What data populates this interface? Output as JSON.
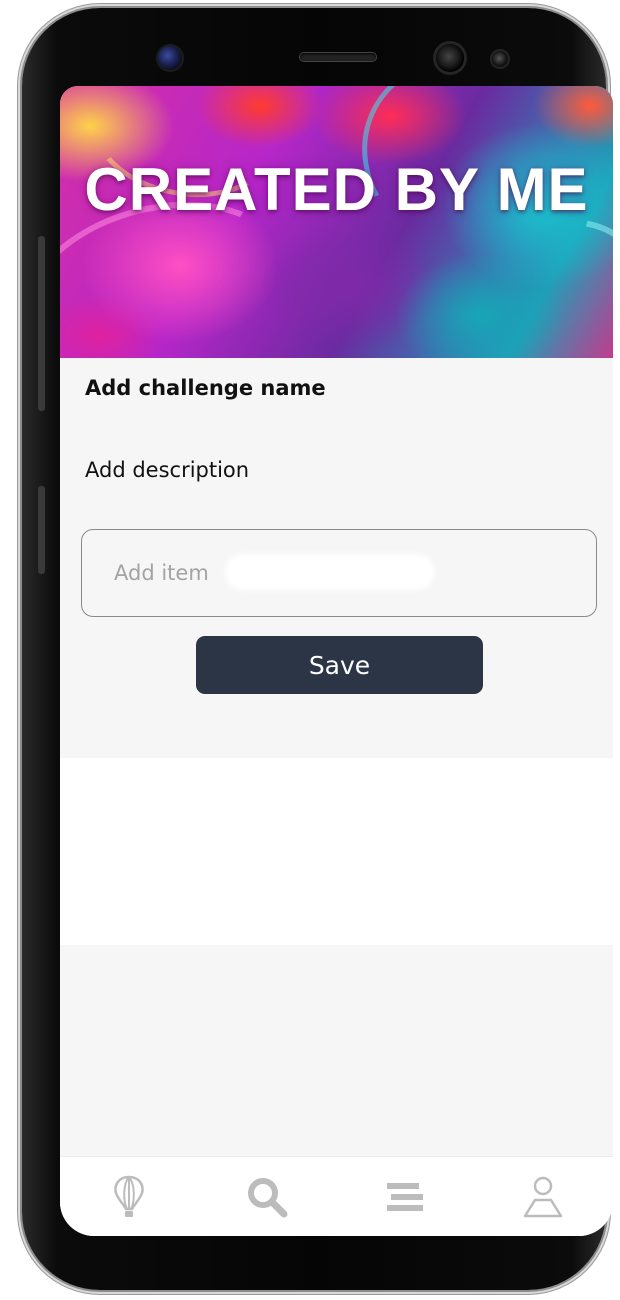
{
  "banner": {
    "title": "CREATED BY ME"
  },
  "challenge": {
    "name_label": "Add challenge name",
    "description_label": "Add description",
    "item_placeholder": "Add item",
    "item_value": ""
  },
  "actions": {
    "save_label": "Save"
  },
  "bottom_nav": {
    "items": [
      {
        "icon": "balloon-icon"
      },
      {
        "icon": "search-icon"
      },
      {
        "icon": "list-icon"
      },
      {
        "icon": "profile-icon"
      }
    ],
    "icon_color": "#bcbcbc"
  },
  "colors": {
    "save_button": "#2c3545",
    "background": "#f6f6f6"
  }
}
